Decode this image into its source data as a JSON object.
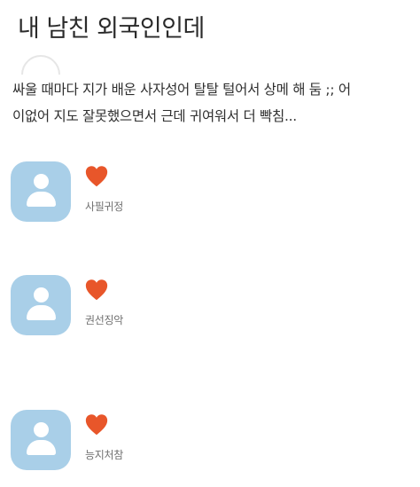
{
  "post": {
    "title": "내 남친 외국인인데",
    "body": "싸울 때마다 지가 배운 사자성어 탈탈 털어서 상메 해 둠 ;; 어\n이없어 지도 잘못했으면서 근데 귀여워서 더 빡침..."
  },
  "comments": [
    {
      "author": "사필귀정",
      "reaction": "heart",
      "avatar": "default-user-avatar"
    },
    {
      "author": "권선징악",
      "reaction": "heart",
      "avatar": "default-user-avatar"
    },
    {
      "author": "능지처참",
      "reaction": "heart",
      "avatar": "default-user-avatar"
    }
  ],
  "colors": {
    "avatar_bg": "#a9cfe8",
    "heart": "#e8562a",
    "author_text": "#6f6f6f"
  }
}
